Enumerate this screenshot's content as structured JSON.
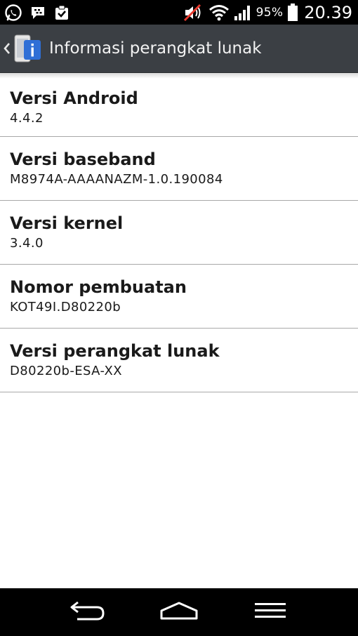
{
  "status_bar": {
    "battery_percent": "95%",
    "time": "20.39",
    "icons": [
      "whatsapp-icon",
      "bbm-icon",
      "task-icon",
      "mute-icon",
      "wifi-icon",
      "signal-icon",
      "battery-icon"
    ]
  },
  "action_bar": {
    "title": "Informasi perangkat lunak",
    "icon": "phone-info-icon"
  },
  "items": [
    {
      "title": "Versi Android",
      "value": "4.4.2"
    },
    {
      "title": "Versi baseband",
      "value": "M8974A-AAAANAZM-1.0.190084"
    },
    {
      "title": "Versi kernel",
      "value": "3.4.0"
    },
    {
      "title": "Nomor pembuatan",
      "value": "KOT49I.D80220b"
    },
    {
      "title": "Versi perangkat lunak",
      "value": "D80220b-ESA-XX"
    }
  ],
  "nav_bar": {
    "buttons": [
      "back-icon",
      "home-icon",
      "menu-icon"
    ]
  },
  "colors": {
    "status_bar_bg": "#000000",
    "action_bar_bg": "#3b3f44",
    "divider": "#a8a8a8",
    "info_blue": "#2f6fd6"
  }
}
